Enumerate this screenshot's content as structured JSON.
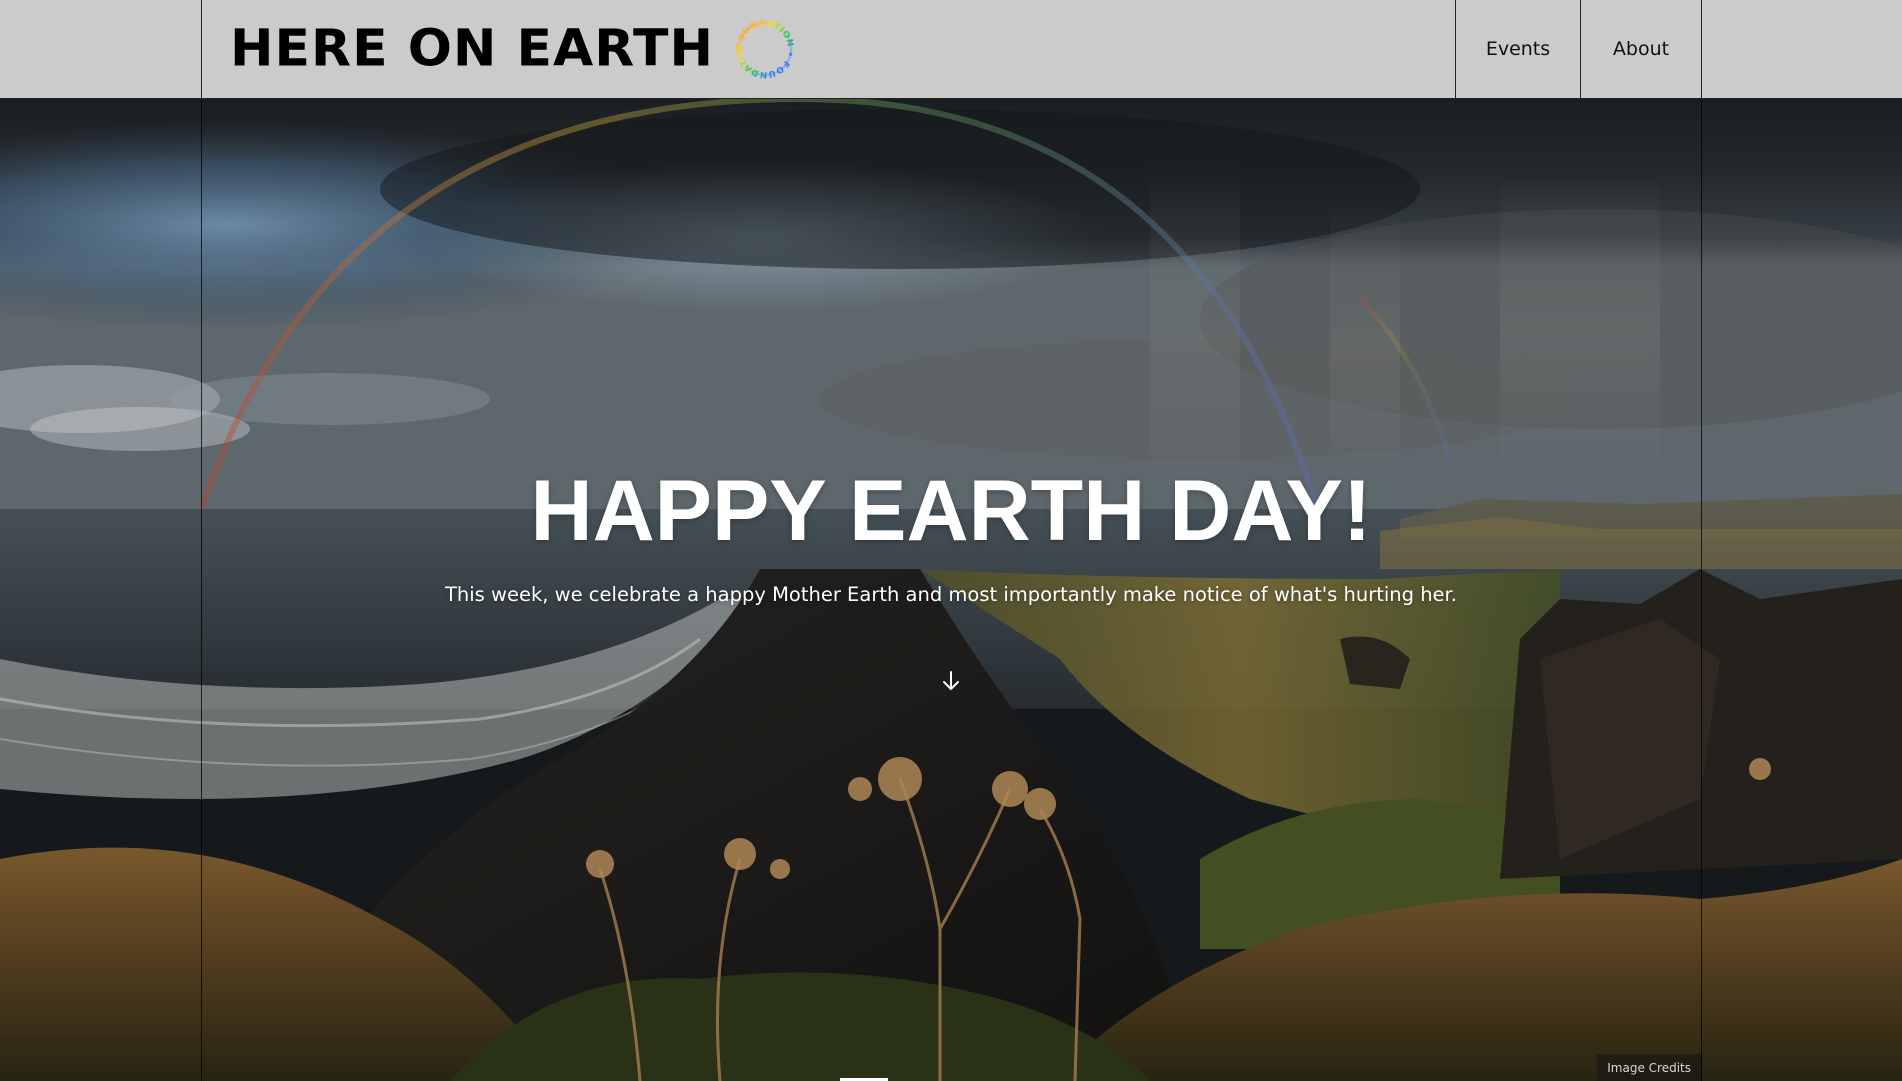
{
  "header": {
    "brand": "HERE ON EARTH",
    "badge_text": "FOUNDATION • FOUNDATION •",
    "nav": [
      {
        "label": "Events"
      },
      {
        "label": "About"
      }
    ]
  },
  "hero": {
    "title": "HAPPY EARTH DAY!",
    "subtitle": "This week, we celebrate a happy Mother Earth and most importantly make notice of what's hurting her.",
    "scroll_icon": "arrow-down-icon",
    "credits_label": "Image Credits"
  },
  "colors": {
    "header_bg": "#cbcbcb",
    "rule": "#222222",
    "hero_text": "#ffffff"
  }
}
